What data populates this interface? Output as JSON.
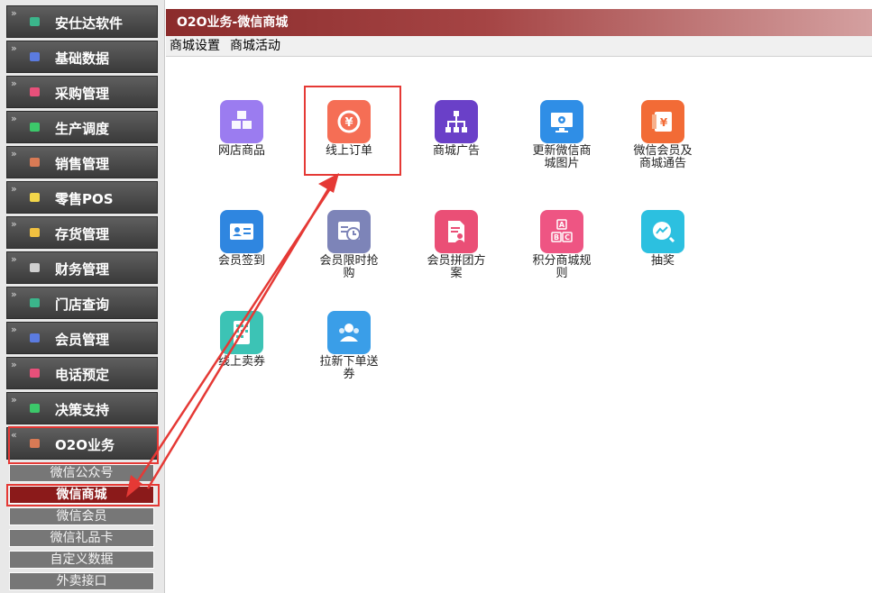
{
  "sidebar": {
    "items": [
      {
        "label": "安仕达软件",
        "color": "#3bb58b"
      },
      {
        "label": "基础数据",
        "color": "#5b7be0"
      },
      {
        "label": "采购管理",
        "color": "#e8507a"
      },
      {
        "label": "生产调度",
        "color": "#3cc86a"
      },
      {
        "label": "销售管理",
        "color": "#d87a55"
      },
      {
        "label": "零售POS",
        "color": "#f2d64a"
      },
      {
        "label": "存货管理",
        "color": "#f0c040"
      },
      {
        "label": "财务管理",
        "color": "#cfcfcf"
      },
      {
        "label": "门店查询",
        "color": "#3bb58b"
      },
      {
        "label": "会员管理",
        "color": "#5b7be0"
      },
      {
        "label": "电话预定",
        "color": "#e8507a"
      },
      {
        "label": "决策支持",
        "color": "#3cc86a"
      },
      {
        "label": "O2O业务",
        "color": "#d87a55"
      }
    ],
    "sub_items": [
      "微信公众号",
      "微信商城",
      "微信会员",
      "微信礼品卡",
      "自定义数据",
      "外卖接口"
    ],
    "active_sub": "微信商城"
  },
  "header": {
    "title": "O2O业务-微信商城"
  },
  "menubar": {
    "items": [
      "商城设置",
      "商城活动"
    ]
  },
  "tiles": [
    {
      "line1": "网店商品",
      "line2": "",
      "icon": "cube-stack-icon",
      "color": "#9b7cf0"
    },
    {
      "line1": "线上订单",
      "line2": "",
      "icon": "yen-refresh-icon",
      "color": "#f56e55"
    },
    {
      "line1": "商城广告",
      "line2": "",
      "icon": "org-chart-icon",
      "color": "#6a40c8"
    },
    {
      "line1": "更新微信商",
      "line2": "城图片",
      "icon": "monitor-gear-icon",
      "color": "#2f8ee6"
    },
    {
      "line1": "微信会员及",
      "line2": "商城通告",
      "icon": "yen-card-icon",
      "color": "#f26b36"
    },
    {
      "line1": "会员签到",
      "line2": "",
      "icon": "id-card-icon",
      "color": "#2f86e0"
    },
    {
      "line1": "会员限时抢",
      "line2": "购",
      "icon": "timer-list-icon",
      "color": "#7d84b8"
    },
    {
      "line1": "会员拼团方",
      "line2": "案",
      "icon": "doc-user-icon",
      "color": "#ea4f76"
    },
    {
      "line1": "积分商城规",
      "line2": "则",
      "icon": "abc-blocks-icon",
      "color": "#ee5583"
    },
    {
      "line1": "抽奖",
      "line2": "",
      "icon": "chart-circle-icon",
      "color": "#2cc0e0"
    },
    {
      "line1": "线上卖券",
      "line2": "",
      "icon": "coupon-icon",
      "color": "#3cc3b5"
    },
    {
      "line1": "拉新下单送",
      "line2": "券",
      "icon": "users-icon",
      "color": "#3a9ee8"
    }
  ]
}
